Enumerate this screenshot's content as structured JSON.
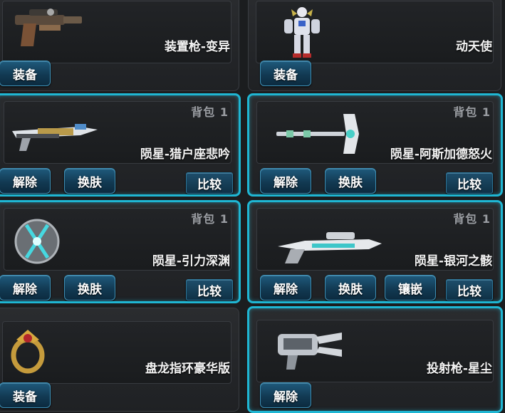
{
  "colors": {
    "selected_border": "#1fb6d3",
    "button_bg": "#123a53"
  },
  "cards": [
    {
      "name": "装置枪-变异",
      "icon": "pistol-icon",
      "buttons": [
        "装备"
      ]
    },
    {
      "name": "动天使",
      "icon": "mecha-angel-icon",
      "buttons": [
        "装备"
      ]
    },
    {
      "name": "陨星-猎户座悲吟",
      "icon": "rifle-icon",
      "bag": "背包 1",
      "buttons": [
        "解除",
        "换肤",
        "比较"
      ]
    },
    {
      "name": "陨星-阿斯加德怒火",
      "icon": "hammer-staff-icon",
      "bag": "背包 1",
      "buttons": [
        "解除",
        "换肤",
        "比较"
      ]
    },
    {
      "name": "陨星-引力深渊",
      "icon": "orb-icon",
      "bag": "背包 1",
      "buttons": [
        "解除",
        "换肤",
        "比较"
      ]
    },
    {
      "name": "陨星-银河之骸",
      "icon": "sniper-rifle-icon",
      "bag": "背包 1",
      "buttons": [
        "解除",
        "换肤",
        "镶嵌",
        "比较"
      ]
    },
    {
      "name": "盘龙指环豪华版",
      "icon": "dragon-ring-icon",
      "buttons": [
        "装备"
      ]
    },
    {
      "name": "投射枪-星尘",
      "icon": "launcher-icon",
      "buttons": [
        "解除"
      ]
    }
  ]
}
